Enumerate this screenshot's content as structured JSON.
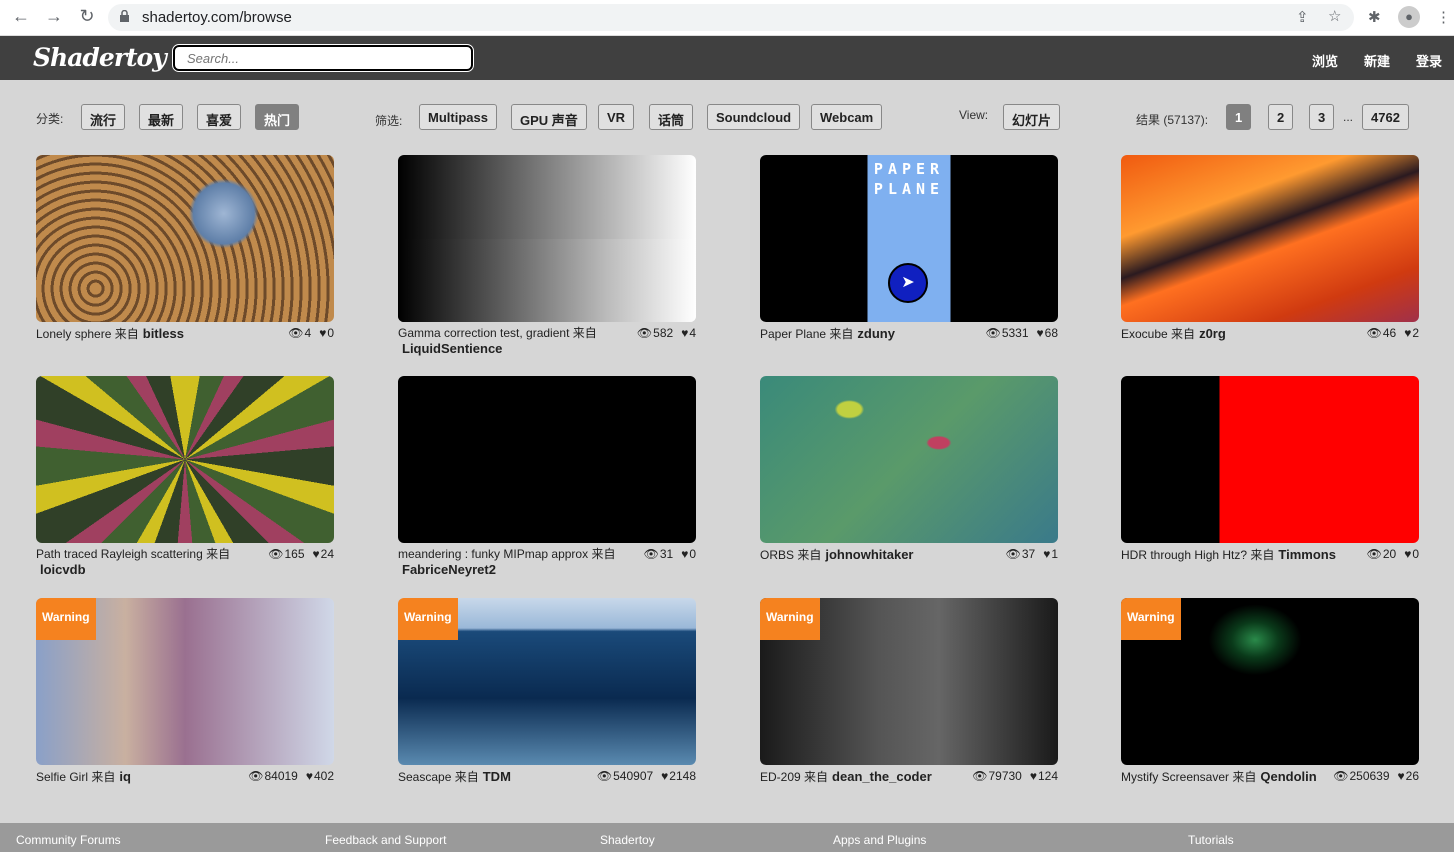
{
  "browser": {
    "url": "shadertoy.com/browse"
  },
  "header": {
    "logo": "Shadertoy",
    "search_placeholder": "Search...",
    "nav": [
      "浏览",
      "新建",
      "登录"
    ]
  },
  "toolbar": {
    "sort_label": "分类:",
    "sort": [
      "流行",
      "最新",
      "喜爱",
      "热门"
    ],
    "sort_selected": "热门",
    "filter_label": "筛选:",
    "filters": [
      "Multipass",
      "GPU 声音",
      "VR",
      "话筒",
      "Soundcloud",
      "Webcam"
    ],
    "view_label": "View:",
    "view": "幻灯片",
    "results_label": "结果 (57137):",
    "pages": [
      "1",
      "2",
      "3",
      "4762"
    ],
    "ellipsis": "...",
    "current_page": "1"
  },
  "by": "来自",
  "warning": "Warning",
  "shaders": [
    {
      "title": "Lonely sphere",
      "author": "bitless",
      "views": "4",
      "likes": "0"
    },
    {
      "title": "Gamma correction test, gradient",
      "author": "LiquidSentience",
      "views": "582",
      "likes": "4"
    },
    {
      "title": "Paper Plane",
      "author": "zduny",
      "views": "5331",
      "likes": "68"
    },
    {
      "title": "Exocube",
      "author": "z0rg",
      "views": "46",
      "likes": "2"
    },
    {
      "title": "Path traced Rayleigh scattering",
      "author": "loicvdb",
      "views": "165",
      "likes": "24"
    },
    {
      "title": "meandering : funky MIPmap approx",
      "author": "FabriceNeyret2",
      "views": "31",
      "likes": "0"
    },
    {
      "title": "ORBS",
      "author": "johnowhitaker",
      "views": "37",
      "likes": "1"
    },
    {
      "title": "HDR through High Htz?",
      "author": "Timmons",
      "views": "20",
      "likes": "0"
    },
    {
      "title": "Selfie Girl",
      "author": "iq",
      "views": "84019",
      "likes": "402",
      "warning": true
    },
    {
      "title": "Seascape",
      "author": "TDM",
      "views": "540907",
      "likes": "2148",
      "warning": true
    },
    {
      "title": "ED-209",
      "author": "dean_the_coder",
      "views": "79730",
      "likes": "124",
      "warning": true
    },
    {
      "title": "Mystify Screensaver",
      "author": "Qendolin",
      "views": "250639",
      "likes": "26",
      "warning": true
    }
  ],
  "paper_plane_text": "PAPER PLANE",
  "footer": [
    "Community Forums",
    "Feedback and Support",
    "Shadertoy",
    "Apps and Plugins",
    "Tutorials"
  ]
}
